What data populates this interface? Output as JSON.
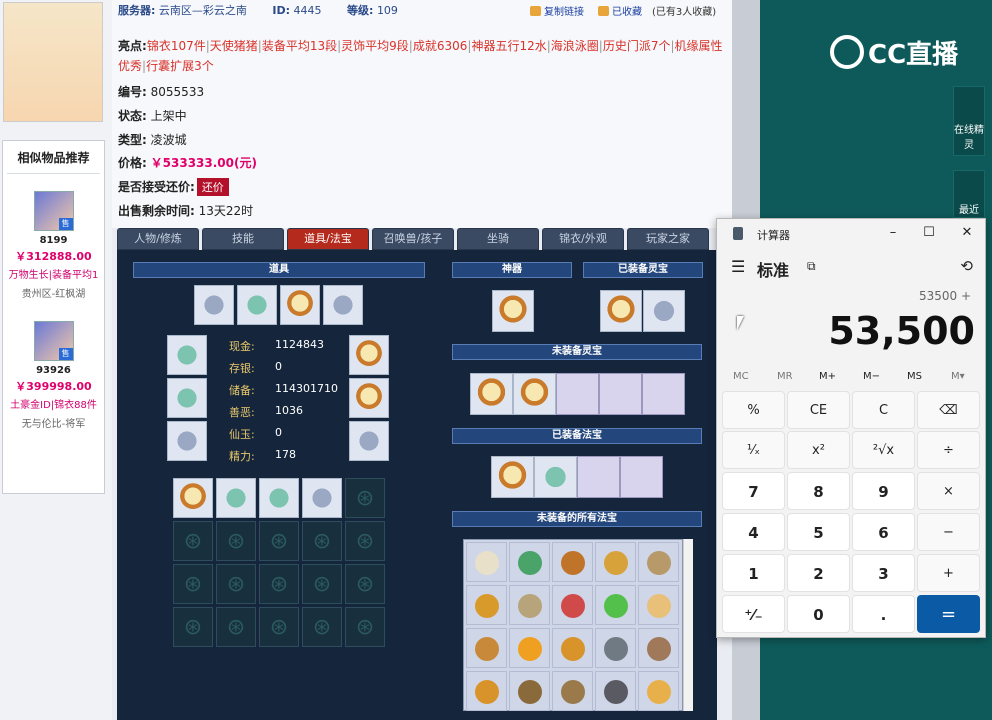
{
  "listing": {
    "server_label": "服务器:",
    "server_value": "云南区—彩云之南",
    "id_label": "ID:",
    "id_value": "4445",
    "level_label": "等级:",
    "level_value": "109",
    "copy_link": "复制链接",
    "favorited": "已收藏",
    "fav_count_text": "(已有3人收藏)",
    "highlights_label": "亮点:",
    "highlights": [
      "锦衣107件",
      "天使猪猪",
      "装备平均13段",
      "灵饰平均9段",
      "成就6306",
      "神器五行12水",
      "海浪泳圈",
      "历史门派7个",
      "机缘属性优秀",
      "行囊扩展3个"
    ],
    "serial_label": "编号:",
    "serial_value": "8055533",
    "status_label": "状态:",
    "status_value": "上架中",
    "type_label": "类型:",
    "type_value": "凌波城",
    "price_label": "价格:",
    "price_value": "￥533333.00(元)",
    "bargain_label": "是否接受还价:",
    "bargain_button": "还价",
    "time_label": "出售剩余时间:",
    "time_value": "13天22时"
  },
  "recommend": {
    "title": "相似物品推荐",
    "items": [
      {
        "id": "8199",
        "price": "￥312888.00",
        "tags": "万物生长|装备平均1",
        "server": "贵州区-红枫湖",
        "tag": "售"
      },
      {
        "id": "93926",
        "price": "￥399998.00",
        "tags": "土豪金ID|锦衣88件",
        "server": "无与伦比-将军",
        "tag": "售"
      }
    ]
  },
  "tabs": [
    "人物/修炼",
    "技能",
    "道具/法宝",
    "召唤兽/孩子",
    "坐骑",
    "锦衣/外观",
    "玩家之家"
  ],
  "active_tab": 2,
  "game": {
    "items_title": "道具",
    "artifact_title": "神器",
    "equipped_lingbao": "已装备灵宝",
    "unequipped_lingbao": "未装备灵宝",
    "equipped_fabao": "已装备法宝",
    "unequipped_fabao": "未装备的所有法宝",
    "money": [
      {
        "label": "现金:",
        "value": "1124843"
      },
      {
        "label": "存银:",
        "value": "0"
      },
      {
        "label": "储备:",
        "value": "114301710"
      },
      {
        "label": "善恶:",
        "value": "1036"
      },
      {
        "label": "仙玉:",
        "value": "0"
      },
      {
        "label": "精力:",
        "value": "178"
      }
    ]
  },
  "rightpanel": {
    "logo": "CC直播",
    "online_helper": "在线精灵",
    "recent": "最近"
  },
  "calculator": {
    "title": "计算器",
    "mode": "标准",
    "expression": "53500 +",
    "display": "53,500",
    "memory": [
      "MC",
      "MR",
      "M+",
      "M−",
      "MS",
      "M▾"
    ],
    "keys": [
      [
        "%",
        "CE",
        "C",
        "⌫"
      ],
      [
        "¹⁄ₓ",
        "x²",
        "²√x",
        "÷"
      ],
      [
        "7",
        "8",
        "9",
        "×"
      ],
      [
        "4",
        "5",
        "6",
        "−"
      ],
      [
        "1",
        "2",
        "3",
        "+"
      ],
      [
        "⁺⁄₋",
        "0",
        ".",
        "="
      ]
    ]
  },
  "colors": {
    "accent_red": "#b42a1c",
    "price_pink": "#e0006a",
    "calc_equals": "#0b5aa6",
    "panel_dark": "#14253c",
    "right_teal": "#0e5a5a"
  }
}
